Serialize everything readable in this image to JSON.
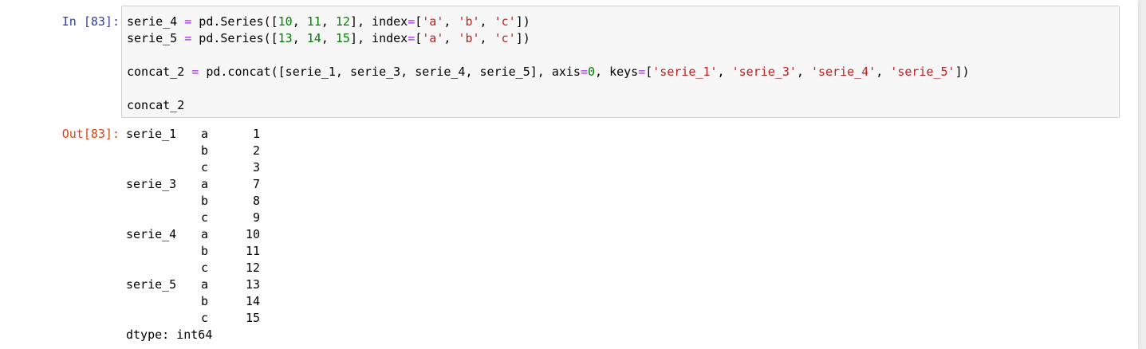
{
  "cell": {
    "in_prompt": "In [83]:",
    "out_prompt": "Out[83]:",
    "code_lines": [
      [
        {
          "t": "serie_4 ",
          "c": "kw"
        },
        {
          "t": "=",
          "c": "op"
        },
        {
          "t": " pd.Series([",
          "c": "kw"
        },
        {
          "t": "10",
          "c": "num"
        },
        {
          "t": ", ",
          "c": "kw"
        },
        {
          "t": "11",
          "c": "num"
        },
        {
          "t": ", ",
          "c": "kw"
        },
        {
          "t": "12",
          "c": "num"
        },
        {
          "t": "], index",
          "c": "kw"
        },
        {
          "t": "=",
          "c": "op"
        },
        {
          "t": "[",
          "c": "kw"
        },
        {
          "t": "'a'",
          "c": "str"
        },
        {
          "t": ", ",
          "c": "kw"
        },
        {
          "t": "'b'",
          "c": "str"
        },
        {
          "t": ", ",
          "c": "kw"
        },
        {
          "t": "'c'",
          "c": "str"
        },
        {
          "t": "])",
          "c": "kw"
        }
      ],
      [
        {
          "t": "serie_5 ",
          "c": "kw"
        },
        {
          "t": "=",
          "c": "op"
        },
        {
          "t": " pd.Series([",
          "c": "kw"
        },
        {
          "t": "13",
          "c": "num"
        },
        {
          "t": ", ",
          "c": "kw"
        },
        {
          "t": "14",
          "c": "num"
        },
        {
          "t": ", ",
          "c": "kw"
        },
        {
          "t": "15",
          "c": "num"
        },
        {
          "t": "], index",
          "c": "kw"
        },
        {
          "t": "=",
          "c": "op"
        },
        {
          "t": "[",
          "c": "kw"
        },
        {
          "t": "'a'",
          "c": "str"
        },
        {
          "t": ", ",
          "c": "kw"
        },
        {
          "t": "'b'",
          "c": "str"
        },
        {
          "t": ", ",
          "c": "kw"
        },
        {
          "t": "'c'",
          "c": "str"
        },
        {
          "t": "])",
          "c": "kw"
        }
      ],
      [],
      [
        {
          "t": "concat_2 ",
          "c": "kw"
        },
        {
          "t": "=",
          "c": "op"
        },
        {
          "t": " pd.concat([serie_1, serie_3, serie_4, serie_5], axis",
          "c": "kw"
        },
        {
          "t": "=",
          "c": "op"
        },
        {
          "t": "0",
          "c": "num"
        },
        {
          "t": ", keys",
          "c": "kw"
        },
        {
          "t": "=",
          "c": "op"
        },
        {
          "t": "[",
          "c": "kw"
        },
        {
          "t": "'serie_1'",
          "c": "str"
        },
        {
          "t": ", ",
          "c": "kw"
        },
        {
          "t": "'serie_3'",
          "c": "str"
        },
        {
          "t": ", ",
          "c": "kw"
        },
        {
          "t": "'serie_4'",
          "c": "str"
        },
        {
          "t": ", ",
          "c": "kw"
        },
        {
          "t": "'serie_5'",
          "c": "str"
        },
        {
          "t": "])",
          "c": "kw"
        }
      ],
      [],
      [
        {
          "t": "concat_2",
          "c": "kw"
        }
      ]
    ],
    "output_rows": [
      {
        "key": "serie_1",
        "idx": "a",
        "val": "1"
      },
      {
        "key": "",
        "idx": "b",
        "val": "2"
      },
      {
        "key": "",
        "idx": "c",
        "val": "3"
      },
      {
        "key": "serie_3",
        "idx": "a",
        "val": "7"
      },
      {
        "key": "",
        "idx": "b",
        "val": "8"
      },
      {
        "key": "",
        "idx": "c",
        "val": "9"
      },
      {
        "key": "serie_4",
        "idx": "a",
        "val": "10"
      },
      {
        "key": "",
        "idx": "b",
        "val": "11"
      },
      {
        "key": "",
        "idx": "c",
        "val": "12"
      },
      {
        "key": "serie_5",
        "idx": "a",
        "val": "13"
      },
      {
        "key": "",
        "idx": "b",
        "val": "14"
      },
      {
        "key": "",
        "idx": "c",
        "val": "15"
      }
    ],
    "dtype_line": "dtype: int64"
  },
  "colors": {
    "in_prompt": "#303f9f",
    "out_prompt": "#d84315",
    "number": "#008000",
    "string": "#ba2121",
    "operator": "#aa22ff"
  }
}
